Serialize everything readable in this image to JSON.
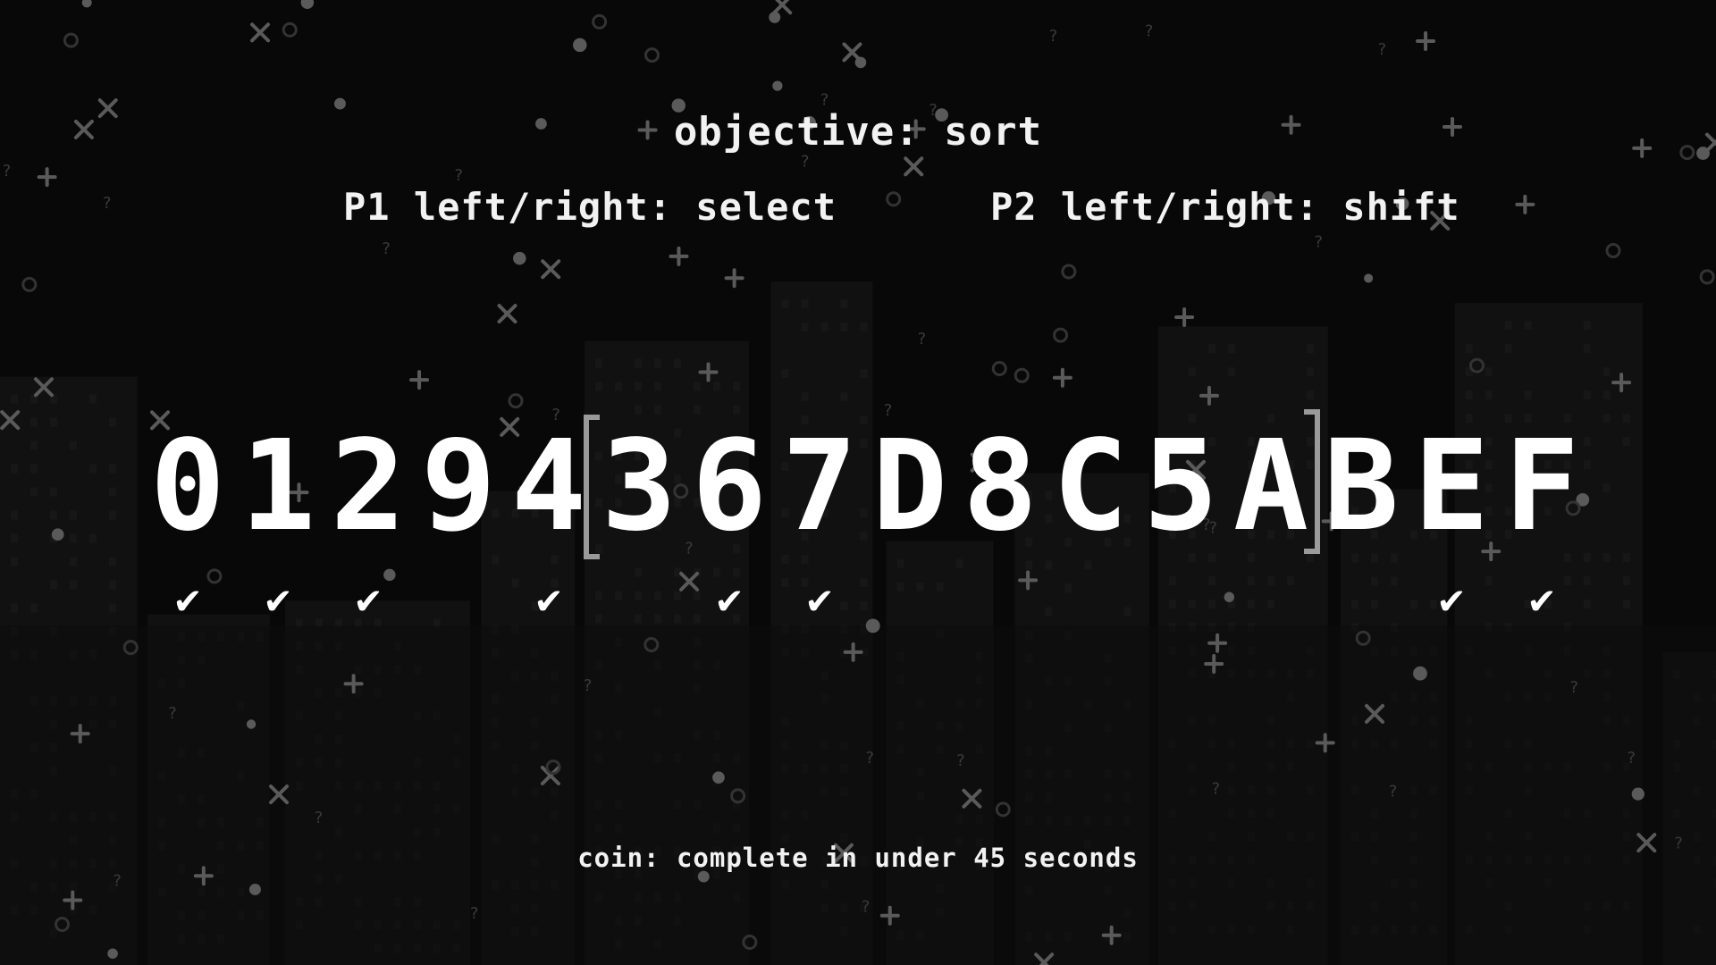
{
  "hud": {
    "objective": "objective: sort",
    "p1_controls": "P1 left/right: select",
    "p2_controls": "P2 left/right: shift",
    "coin_goal": "coin: complete in under 45 seconds"
  },
  "sequence": {
    "tiles": [
      {
        "label": "0",
        "sorted": true
      },
      {
        "label": "1",
        "sorted": true
      },
      {
        "label": "2",
        "sorted": true
      },
      {
        "label": "9",
        "sorted": false
      },
      {
        "label": "4",
        "sorted": true
      },
      {
        "label": "3",
        "sorted": false
      },
      {
        "label": "6",
        "sorted": true
      },
      {
        "label": "7",
        "sorted": true
      },
      {
        "label": "D",
        "sorted": false
      },
      {
        "label": "8",
        "sorted": false
      },
      {
        "label": "C",
        "sorted": false
      },
      {
        "label": "5",
        "sorted": false
      },
      {
        "label": "A",
        "sorted": false
      },
      {
        "label": "B",
        "sorted": false
      },
      {
        "label": "E",
        "sorted": true
      },
      {
        "label": "F",
        "sorted": true
      }
    ],
    "selection": {
      "start": 5,
      "end": 12
    },
    "check_icon": "checkmark-icon",
    "check_glyph": "✔"
  },
  "colors": {
    "background": "#080808",
    "text": "#ffffff",
    "bracket": "#9a9a9a",
    "particles": "#5a5a5a",
    "buildings": "#111111"
  }
}
